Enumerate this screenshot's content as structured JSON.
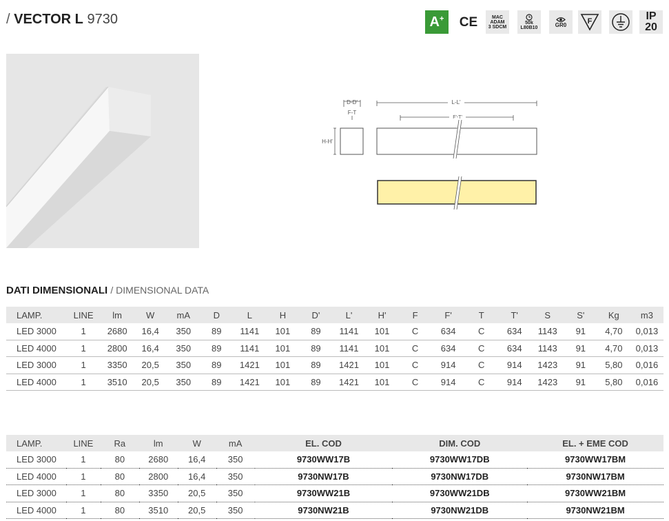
{
  "header": {
    "slash": "/ ",
    "name": "VECTOR L",
    "code": " 9730"
  },
  "badges": {
    "energy_class": "A",
    "energy_plus": "+",
    "ce": "CE",
    "macadam": [
      "MAC",
      "ADAM",
      "3 SDCM"
    ],
    "lifetime": [
      "50k",
      "L80B10"
    ],
    "risk_group": "GR0",
    "f_mark": "F",
    "ip": [
      "IP",
      "20"
    ],
    "energy_color": "#3a9a37"
  },
  "diagram": {
    "dd": "D-D'",
    "ft": "F-T",
    "hh": "H-H'",
    "ll": "L-L'",
    "ftp": "F'-T'",
    "light_color": "#fff1a8"
  },
  "dimensional": {
    "title": "DATI DIMENSIONALI",
    "subtitle": "/ DIMENSIONAL DATA",
    "headers": [
      "LAMP.",
      "LINE",
      "lm",
      "W",
      "mA",
      "D",
      "L",
      "H",
      "D'",
      "L'",
      "H'",
      "F",
      "F'",
      "T",
      "T'",
      "S",
      "S'",
      "Kg",
      "m3"
    ],
    "rows": [
      [
        "LED 3000",
        "1",
        "2680",
        "16,4",
        "350",
        "89",
        "1141",
        "101",
        "89",
        "1141",
        "101",
        "C",
        "634",
        "C",
        "634",
        "1143",
        "91",
        "4,70",
        "0,013"
      ],
      [
        "LED 4000",
        "1",
        "2800",
        "16,4",
        "350",
        "89",
        "1141",
        "101",
        "89",
        "1141",
        "101",
        "C",
        "634",
        "C",
        "634",
        "1143",
        "91",
        "4,70",
        "0,013"
      ],
      [
        "LED 3000",
        "1",
        "3350",
        "20,5",
        "350",
        "89",
        "1421",
        "101",
        "89",
        "1421",
        "101",
        "C",
        "914",
        "C",
        "914",
        "1423",
        "91",
        "5,80",
        "0,016"
      ],
      [
        "LED 4000",
        "1",
        "3510",
        "20,5",
        "350",
        "89",
        "1421",
        "101",
        "89",
        "1421",
        "101",
        "C",
        "914",
        "C",
        "914",
        "1423",
        "91",
        "5,80",
        "0,016"
      ]
    ]
  },
  "codes": {
    "headers": [
      "LAMP.",
      "LINE",
      "Ra",
      "lm",
      "W",
      "mA",
      "EL. COD",
      "DIM. COD",
      "EL. + EME COD"
    ],
    "rows": [
      [
        "LED 3000",
        "1",
        "80",
        "2680",
        "16,4",
        "350",
        "9730WW17B",
        "9730WW17DB",
        "9730WW17BM"
      ],
      [
        "LED 4000",
        "1",
        "80",
        "2800",
        "16,4",
        "350",
        "9730NW17B",
        "9730NW17DB",
        "9730NW17BM"
      ],
      [
        "LED 3000",
        "1",
        "80",
        "3350",
        "20,5",
        "350",
        "9730WW21B",
        "9730WW21DB",
        "9730WW21BM"
      ],
      [
        "LED 4000",
        "1",
        "80",
        "3510",
        "20,5",
        "350",
        "9730NW21B",
        "9730NW21DB",
        "9730NW21BM"
      ]
    ]
  }
}
